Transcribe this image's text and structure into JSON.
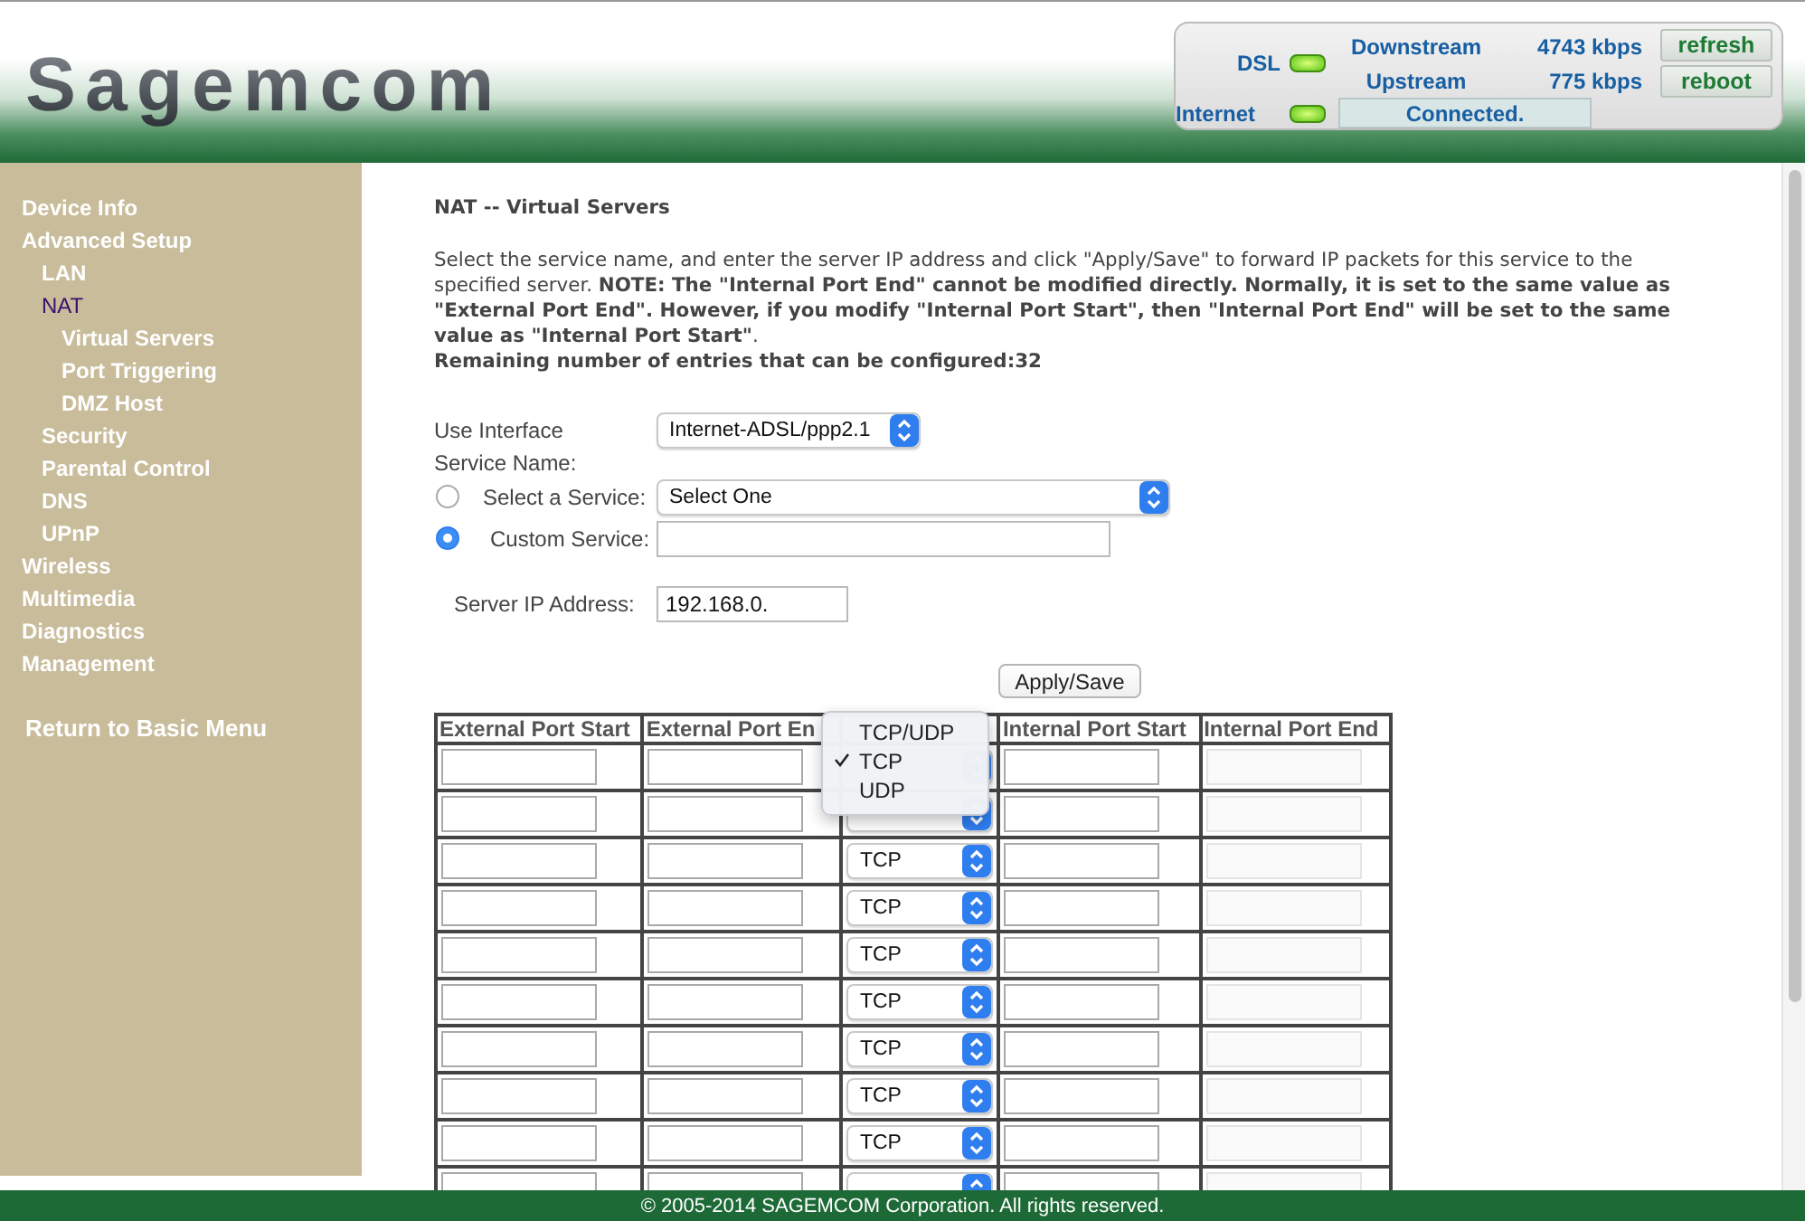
{
  "header": {
    "logo": "Sagemcom",
    "status": {
      "dsl_label": "DSL",
      "dsl_on": true,
      "downstream_label": "Downstream",
      "downstream_value": "4743 kbps",
      "upstream_label": "Upstream",
      "upstream_value": "775 kbps",
      "internet_label": "Internet",
      "internet_on": true,
      "connection": "Connected.",
      "buttons": [
        "refresh",
        "reboot"
      ]
    }
  },
  "sidebar": {
    "items": [
      {
        "label": "Device Info",
        "selected": false
      },
      {
        "label": "Advanced Setup",
        "selected": false,
        "children": [
          {
            "label": "LAN",
            "selected": false
          },
          {
            "label": "NAT",
            "selected": true,
            "children": [
              {
                "label": "Virtual Servers",
                "selected": false
              },
              {
                "label": "Port Triggering",
                "selected": false
              },
              {
                "label": "DMZ Host",
                "selected": false
              }
            ]
          },
          {
            "label": "Security",
            "selected": false
          },
          {
            "label": "Parental Control",
            "selected": false
          },
          {
            "label": "DNS",
            "selected": false
          },
          {
            "label": "UPnP",
            "selected": false
          }
        ]
      },
      {
        "label": "Wireless",
        "selected": false
      },
      {
        "label": "Multimedia",
        "selected": false
      },
      {
        "label": "Diagnostics",
        "selected": false
      },
      {
        "label": "Management",
        "selected": false
      }
    ],
    "return_link": "Return to Basic Menu"
  },
  "content": {
    "title": "NAT -- Virtual Servers",
    "description": "Select the service name, and enter the server IP address and click \"Apply/Save\" to forward IP packets for this service to the specified server. **NOTE: The \"Internal Port End\" cannot be modified directly. Normally, it is set to the same value as \"External Port End\". However, if you modify \"Internal Port Start\", then \"Internal Port End\" will be set to the same value as \"Internal Port Start\"**.",
    "remaining": "Remaining number of entries that can be configured:32",
    "use_interface": {
      "label": "Use Interface",
      "value": "Internet-ADSL/ppp2.1"
    },
    "service_name_label": "Service Name:",
    "service_options": [
      {
        "label": "Select a Service:",
        "selected": false,
        "kind": "select",
        "value": "Select One"
      },
      {
        "label": "Custom Service:",
        "selected": true,
        "kind": "text"
      }
    ],
    "server_ip": {
      "label": "Server IP Address:",
      "value": "192.168.0."
    },
    "apply_button": "Apply/Save",
    "table": {
      "columns": [
        {
          "label": "External Port Start",
          "kind": "text",
          "disabled": false
        },
        {
          "label": "External Port En",
          "kind": "text",
          "disabled": false
        },
        {
          "kind": "protocol",
          "disabled": false
        },
        {
          "label": "Internal Port Start",
          "kind": "text",
          "disabled": false
        },
        {
          "label": "Internal Port End",
          "kind": "text",
          "disabled": true
        }
      ],
      "rows": [
        {},
        {},
        {
          "protocol": "TCP"
        },
        {
          "protocol": "TCP"
        },
        {
          "protocol": "TCP"
        },
        {
          "protocol": "TCP"
        },
        {
          "protocol": "TCP"
        },
        {
          "protocol": "TCP"
        },
        {
          "protocol": "TCP"
        },
        {}
      ],
      "protocol_menu": [
        {
          "label": "TCP/UDP",
          "selected": false
        },
        {
          "label": "TCP",
          "selected": true
        },
        {
          "label": "UDP",
          "selected": false
        }
      ]
    }
  },
  "footer": {
    "copyright": "© 2005-2014 SAGEMCOM Corporation. All rights reserved."
  }
}
